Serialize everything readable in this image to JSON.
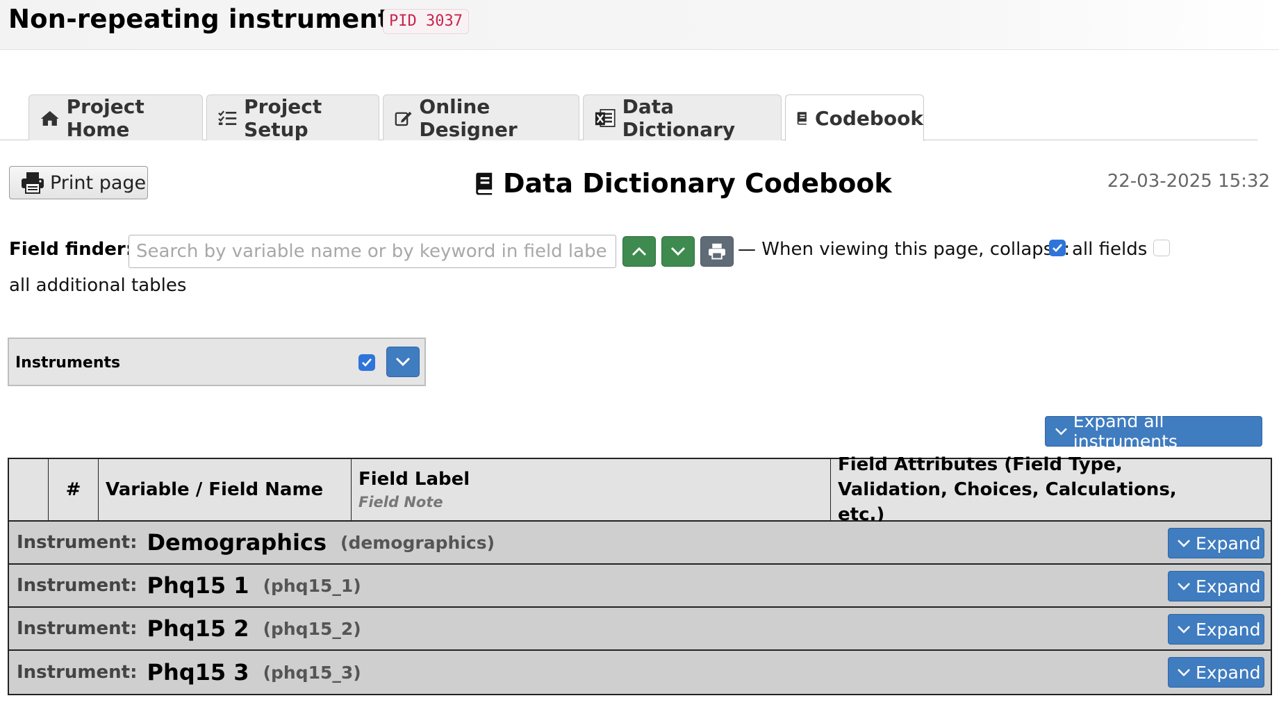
{
  "header": {
    "title": "Non-repeating instruments",
    "pid": "PID 3037"
  },
  "tabs": [
    {
      "label": "Project Home",
      "icon": "home-icon"
    },
    {
      "label": "Project Setup",
      "icon": "checklist-icon"
    },
    {
      "label": "Online Designer",
      "icon": "edit-icon"
    },
    {
      "label": "Data Dictionary",
      "icon": "excel-icon"
    },
    {
      "label": "Codebook",
      "icon": "book-icon",
      "active": true
    }
  ],
  "toolbar": {
    "print_label": "Print page",
    "heading": "Data Dictionary Codebook",
    "timestamp": "22-03-2025 15:32"
  },
  "field_finder": {
    "label": "Field finder:",
    "placeholder": "Search by variable name or by keyword in field label",
    "value": "",
    "collapse_text": "— When viewing this page, collapse:",
    "all_fields_label": "all fields",
    "all_fields_checked": true,
    "all_tables_label": "all additional tables",
    "all_tables_checked": false
  },
  "instruments_box": {
    "title": "Instruments",
    "checked": true
  },
  "expand_all_label": "Expand all instruments",
  "table": {
    "headers": {
      "hash": "#",
      "variable": "Variable / Field Name",
      "label": "Field Label",
      "label_note": "Field Note",
      "attributes": "Field Attributes (Field Type, Validation, Choices, Calculations, etc.)"
    },
    "instrument_prefix": "Instrument:",
    "expand_label": "Expand",
    "instruments": [
      {
        "name": "Demographics",
        "var": "(demographics)"
      },
      {
        "name": "Phq15 1",
        "var": "(phq15_1)"
      },
      {
        "name": "Phq15 2",
        "var": "(phq15_2)"
      },
      {
        "name": "Phq15 3",
        "var": "(phq15_3)"
      }
    ]
  },
  "colors": {
    "accent_blue": "#3f7cc0",
    "nav_green": "#3f8a4f",
    "pid_red": "#c7254e",
    "checkbox_blue": "#2f74d9"
  }
}
